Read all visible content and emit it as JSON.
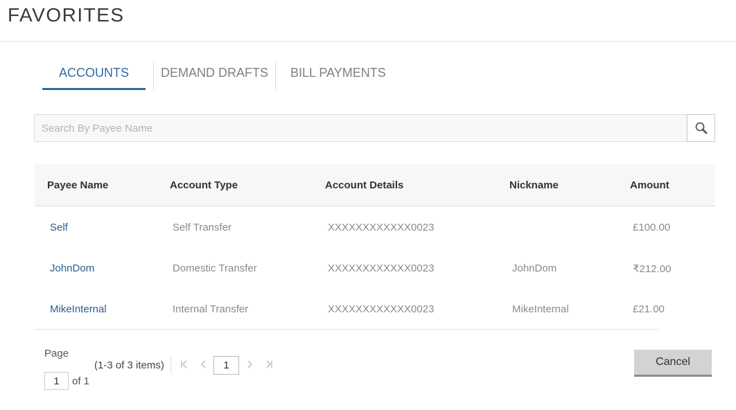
{
  "page": {
    "title": "FAVORITES"
  },
  "tabs": [
    {
      "label": "ACCOUNTS",
      "active": true
    },
    {
      "label": "DEMAND DRAFTS",
      "active": false
    },
    {
      "label": "BILL PAYMENTS",
      "active": false
    }
  ],
  "search": {
    "placeholder": "Search By Payee Name",
    "value": "",
    "icon": "search-icon"
  },
  "table": {
    "headers": [
      "Payee Name",
      "Account Type",
      "Account Details",
      "Nickname",
      "Amount"
    ],
    "rows": [
      {
        "payee": "Self",
        "type": "Self Transfer",
        "details": "XXXXXXXXXXXX0023",
        "nickname": "",
        "amount": "£100.00"
      },
      {
        "payee": "JohnDom",
        "type": "Domestic Transfer",
        "details": "XXXXXXXXXXXX0023",
        "nickname": "JohnDom",
        "amount": "₹212.00"
      },
      {
        "payee": "MikeInternal",
        "type": "Internal Transfer",
        "details": "XXXXXXXXXXXX0023",
        "nickname": "MikeInternal",
        "amount": "£21.00"
      }
    ]
  },
  "pagination": {
    "page_label": "Page",
    "page_value": "1",
    "of_label": "of 1",
    "items_label": "(1-3 of 3 items)",
    "current_page": "1",
    "icons": [
      "first-page-icon",
      "prev-page-icon",
      "next-page-icon",
      "last-page-icon"
    ]
  },
  "actions": {
    "cancel_label": "Cancel"
  },
  "colors": {
    "accent": "#2e6da4",
    "link": "#2a5d8f",
    "muted_text": "#8a8a8a",
    "header_bg": "#f7f7f7",
    "button_bg": "#d3d3d3"
  }
}
